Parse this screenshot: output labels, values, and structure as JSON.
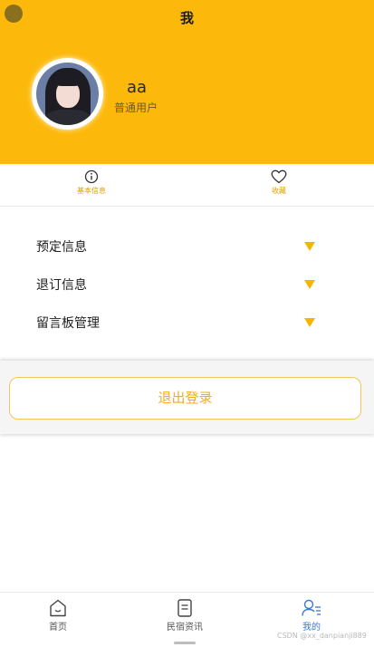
{
  "header": {
    "title": "我",
    "user_name": "aa",
    "user_role": "普通用户"
  },
  "tabs": [
    {
      "label": "基本信息",
      "icon": "info-icon"
    },
    {
      "label": "收藏",
      "icon": "heart-icon"
    }
  ],
  "menu": [
    {
      "label": "预定信息",
      "icon": "chevron-down-icon"
    },
    {
      "label": "退订信息",
      "icon": "chevron-down-icon"
    },
    {
      "label": "留言板管理",
      "icon": "chevron-down-icon"
    }
  ],
  "logout": {
    "label": "退出登录"
  },
  "tabbar": [
    {
      "label": "首页",
      "icon": "home-icon"
    },
    {
      "label": "民宿资讯",
      "icon": "document-icon"
    },
    {
      "label": "我的",
      "icon": "profile-icon",
      "active": true
    }
  ],
  "watermark": "CSDN @xx_danpianji889",
  "colors": {
    "header_bg": "#fdb90b",
    "accent": "#f7b500",
    "active_tab": "#3b78d0"
  }
}
